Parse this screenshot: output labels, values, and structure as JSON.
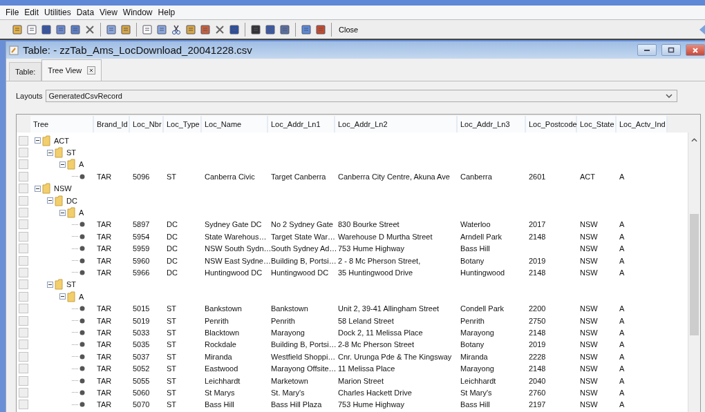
{
  "menu": [
    "File",
    "Edit",
    "Utilities",
    "Data",
    "View",
    "Window",
    "Help"
  ],
  "toolbar": {
    "close_label": "Close"
  },
  "window": {
    "title": "Table: - zzTab_Ams_LocDownload_20041228.csv"
  },
  "tabs": [
    {
      "label": "Table:",
      "selected": false,
      "closable": false
    },
    {
      "label": "Tree View",
      "selected": true,
      "closable": true
    }
  ],
  "layouts": {
    "label": "Layouts",
    "value": "GeneratedCsvRecord"
  },
  "table": {
    "columns": [
      "Tree",
      "Brand_Id",
      "Loc_Nbr",
      "Loc_Type",
      "Loc_Name",
      "Loc_Addr_Ln1",
      "Loc_Addr_Ln2",
      "Loc_Addr_Ln3",
      "Loc_Postcode",
      "Loc_State",
      "Loc_Actv_Ind"
    ],
    "tree": [
      {
        "label": "ACT",
        "expanded": true,
        "children": [
          {
            "label": "ST",
            "expanded": true,
            "children": [
              {
                "label": "A",
                "expanded": true,
                "children": [
                  {
                    "cells": [
                      "TAR",
                      "5096",
                      "ST",
                      "Canberra Civic",
                      "Target Canberra",
                      "Canberra City Centre, Akuna Ave",
                      "Canberra",
                      "2601",
                      "ACT",
                      "A"
                    ]
                  }
                ]
              }
            ]
          }
        ]
      },
      {
        "label": "NSW",
        "expanded": true,
        "children": [
          {
            "label": "DC",
            "expanded": true,
            "children": [
              {
                "label": "A",
                "expanded": true,
                "children": [
                  {
                    "cells": [
                      "TAR",
                      "5897",
                      "DC",
                      "Sydney Gate DC",
                      "No 2 Sydney Gate",
                      "830 Bourke Street",
                      "Waterloo",
                      "2017",
                      "NSW",
                      "A"
                    ]
                  },
                  {
                    "cells": [
                      "TAR",
                      "5954",
                      "DC",
                      "State  Warehous…",
                      "Target State War…",
                      "Warehouse D Murtha Street",
                      "Arndell Park",
                      "2148",
                      "NSW",
                      "A"
                    ]
                  },
                  {
                    "cells": [
                      "TAR",
                      "5959",
                      "DC",
                      "NSW  South Sydn…",
                      "South Sydney Ad…",
                      "753 Hume Highway",
                      "Bass Hill",
                      "",
                      "NSW",
                      "A"
                    ]
                  },
                  {
                    "cells": [
                      "TAR",
                      "5960",
                      "DC",
                      "NSW East Sydne…",
                      " Building B, Portsi…",
                      "2 - 8 Mc Pherson Street,",
                      "Botany",
                      "2019",
                      "NSW",
                      "A"
                    ]
                  },
                  {
                    "cells": [
                      "TAR",
                      "5966",
                      "DC",
                      "Huntingwood DC",
                      "Huntingwood DC",
                      "35 Huntingwood Drive",
                      "Huntingwood",
                      "2148",
                      "NSW",
                      "A"
                    ]
                  }
                ]
              }
            ]
          },
          {
            "label": "ST",
            "expanded": true,
            "children": [
              {
                "label": "A",
                "expanded": true,
                "children": [
                  {
                    "cells": [
                      "TAR",
                      "5015",
                      "ST",
                      "Bankstown",
                      "Bankstown",
                      "Unit 2, 39-41 Allingham Street",
                      "Condell Park",
                      "2200",
                      "NSW",
                      "A"
                    ]
                  },
                  {
                    "cells": [
                      "TAR",
                      "5019",
                      "ST",
                      "Penrith",
                      "Penrith",
                      "58 Leland Street",
                      "Penrith",
                      "2750",
                      "NSW",
                      "A"
                    ]
                  },
                  {
                    "cells": [
                      "TAR",
                      "5033",
                      "ST",
                      "Blacktown",
                      "Marayong",
                      "Dock 2, 11 Melissa Place",
                      "Marayong",
                      "2148",
                      "NSW",
                      "A"
                    ]
                  },
                  {
                    "cells": [
                      "TAR",
                      "5035",
                      "ST",
                      "Rockdale",
                      "Building B,  Portsi…",
                      "2-8 Mc Pherson Street",
                      "Botany",
                      "2019",
                      "NSW",
                      "A"
                    ]
                  },
                  {
                    "cells": [
                      "TAR",
                      "5037",
                      "ST",
                      "Miranda",
                      "Westfield Shoppi…",
                      "Cnr. Urunga Pde & The Kingsway",
                      "Miranda",
                      "2228",
                      "NSW",
                      "A"
                    ]
                  },
                  {
                    "cells": [
                      "TAR",
                      "5052",
                      "ST",
                      "Eastwood",
                      "Marayong Offsite…",
                      "11 Melissa Place",
                      "Marayong",
                      "2148",
                      "NSW",
                      "A"
                    ]
                  },
                  {
                    "cells": [
                      "TAR",
                      "5055",
                      "ST",
                      "Leichhardt",
                      "Marketown",
                      "Marion Street",
                      "Leichhardt",
                      "2040",
                      "NSW",
                      "A"
                    ]
                  },
                  {
                    "cells": [
                      "TAR",
                      "5060",
                      "ST",
                      "St Marys",
                      "St. Mary's",
                      "Charles Hackett Drive",
                      "St Mary's",
                      "2760",
                      "NSW",
                      "A"
                    ]
                  },
                  {
                    "cells": [
                      "TAR",
                      "5070",
                      "ST",
                      "Bass Hill",
                      "Bass Hill Plaza",
                      "753 Hume Highway",
                      "Bass Hill",
                      "2197",
                      "NSW",
                      "A"
                    ]
                  }
                ]
              }
            ]
          }
        ]
      }
    ]
  }
}
